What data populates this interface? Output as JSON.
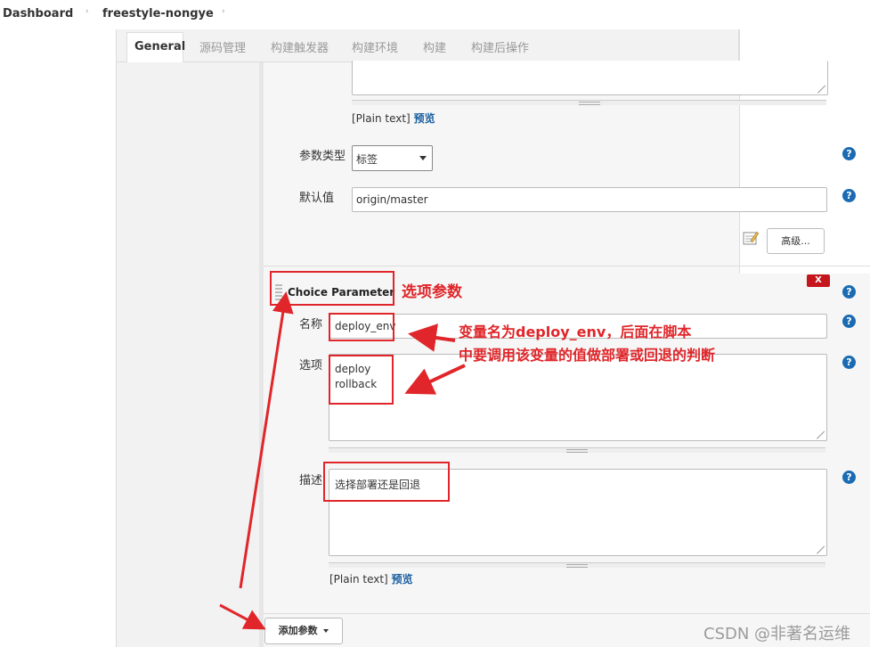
{
  "breadcrumb": {
    "root": "Dashboard",
    "project": "freestyle-nongye",
    "sep": "›"
  },
  "tabs": [
    "General",
    "源码管理",
    "构建触发器",
    "构建环境",
    "构建",
    "构建后操作"
  ],
  "prev_param": {
    "plain_text": "[Plain text]",
    "preview": "预览",
    "type_label": "参数类型",
    "type_value": "标签",
    "default_label": "默认值",
    "default_value": "origin/master",
    "advanced_button": "高级..."
  },
  "choice_param": {
    "header": "Choice Parameter",
    "delete": "X",
    "name_label": "名称",
    "name_value": "deploy_env",
    "choices_label": "选项",
    "choices": [
      "deploy",
      "rollback"
    ],
    "desc_label": "描述",
    "desc_value": "选择部署还是回退",
    "plain_text": "[Plain text]",
    "preview": "预览"
  },
  "add_param_button": "添加参数",
  "help_glyph": "?",
  "annotations": {
    "choice": "选项参数",
    "var_line1": "变量名为deploy_env，后面在脚本",
    "var_line2": "中要调用该变量的值做部署或回退的判断"
  },
  "watermark": "CSDN @非著名运维",
  "colors": {
    "annotation": "#e0262a",
    "help": "#1b6bb3",
    "link": "#1a5fa0",
    "delete": "#c4161c"
  }
}
